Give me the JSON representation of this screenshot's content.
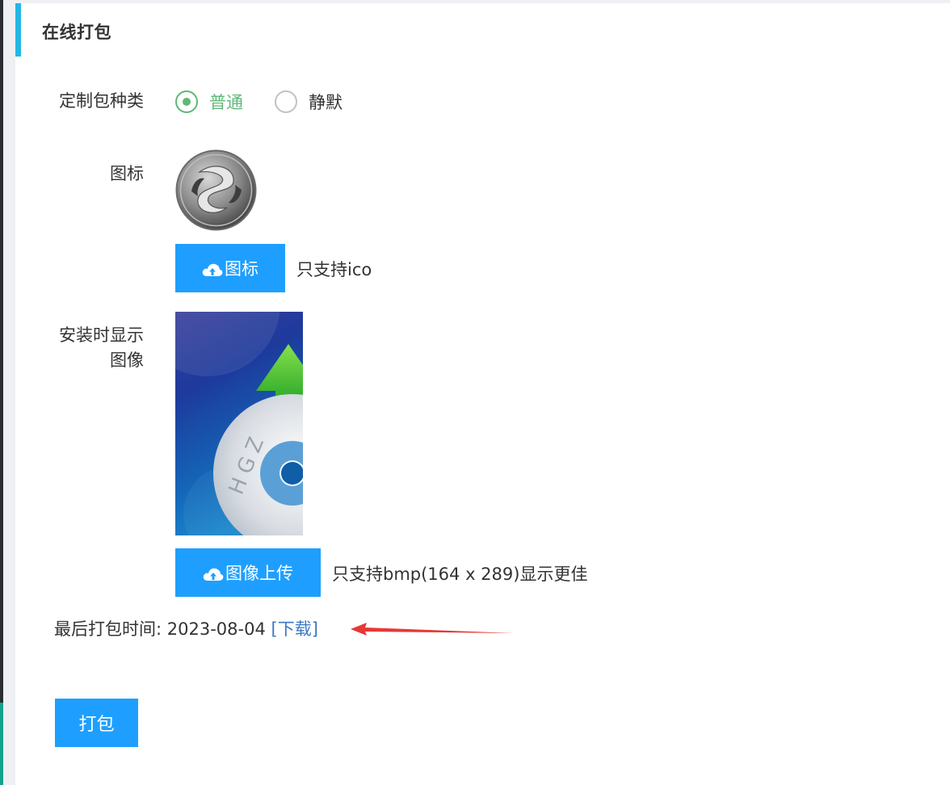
{
  "panel": {
    "title": "在线打包"
  },
  "package_type": {
    "label": "定制包种类",
    "options": [
      {
        "label": "普通",
        "checked": true
      },
      {
        "label": "静默",
        "checked": false
      }
    ]
  },
  "icon_field": {
    "label": "图标",
    "upload_label": "图标",
    "hint": "只支持ico"
  },
  "banner_field": {
    "label_line1": "安装时显示",
    "label_line2": "图像",
    "upload_label": "图像上传",
    "hint": "只支持bmp(164 x 289)显示更佳",
    "image_text": "HGZ"
  },
  "last_pack": {
    "label": "最后打包时间:",
    "date": "2023-08-04",
    "link": "[下载]"
  },
  "pack_button": "打包",
  "colors": {
    "accent_bar": "#23b7e5",
    "primary_button": "#1e9fff",
    "radio_checked": "#5fb878",
    "link": "#3a78c3",
    "annotation_arrow": "#e53935"
  },
  "icons": [
    "cloud-upload-icon",
    "app-icon-image",
    "annotation-arrow"
  ]
}
